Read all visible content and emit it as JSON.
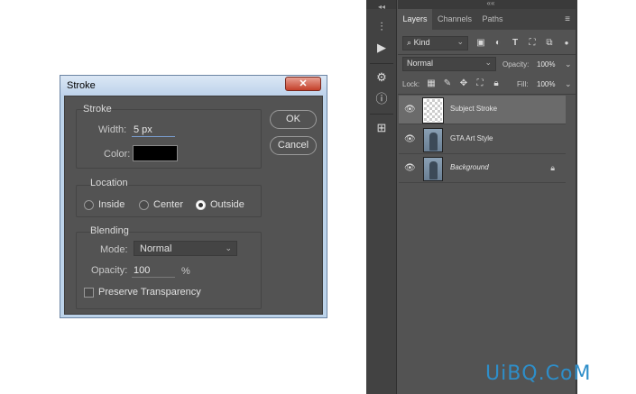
{
  "dialog": {
    "title": "Stroke",
    "close_glyph": "✕",
    "stroke_group": {
      "title": "Stroke",
      "width_label": "Width:",
      "width_value": "5 px",
      "color_label": "Color:",
      "color_value": "#000000"
    },
    "location_group": {
      "title": "Location",
      "options": [
        "Inside",
        "Center",
        "Outside"
      ],
      "selected": "Outside"
    },
    "blending_group": {
      "title": "Blending",
      "mode_label": "Mode:",
      "mode_value": "Normal",
      "opacity_label": "Opacity:",
      "opacity_value": "100",
      "opacity_unit": "%",
      "preserve_label": "Preserve Transparency",
      "preserve_checked": false
    },
    "ok_label": "OK",
    "cancel_label": "Cancel"
  },
  "toolstrip": {
    "icons": [
      "collapse-icon",
      "properties-icon",
      "play-icon",
      "channels-icon",
      "info-icon",
      "adjustments-icon"
    ]
  },
  "layers_panel": {
    "collapse_glyph": "««",
    "tabs": [
      "Layers",
      "Channels",
      "Paths"
    ],
    "active_tab": "Layers",
    "menu_glyph": "≡",
    "filter": {
      "label": "Kind",
      "icons": [
        "image-filter-icon",
        "adjustment-filter-icon",
        "type-filter-icon",
        "shape-filter-icon",
        "smart-object-filter-icon",
        "filter-toggle-icon"
      ]
    },
    "blend_mode": "Normal",
    "opacity_label": "Opacity:",
    "opacity_value": "100%",
    "lock_label": "Lock:",
    "fill_label": "Fill:",
    "fill_value": "100%",
    "layers": [
      {
        "name": "Subject Stroke",
        "thumb": "transparent",
        "selected": true,
        "italic": false,
        "locked": false
      },
      {
        "name": "GTA Art Style",
        "thumb": "photo",
        "selected": false,
        "italic": false,
        "locked": false
      },
      {
        "name": "Background",
        "thumb": "photo",
        "selected": false,
        "italic": true,
        "locked": true
      }
    ]
  },
  "watermark": "UiBQ.CoM"
}
